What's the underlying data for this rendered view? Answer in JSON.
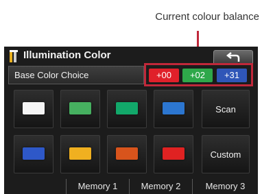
{
  "annotation": {
    "label": "Current colour balance"
  },
  "screen": {
    "title": "Illumination Color",
    "base_color_label": "Base Color Choice",
    "balance": [
      {
        "text": "+00",
        "color": "#e0202a"
      },
      {
        "text": "+02",
        "color": "#2ea84a"
      },
      {
        "text": "+31",
        "color": "#2f56b8"
      }
    ],
    "swatches": [
      {
        "color": "#f4f4f4"
      },
      {
        "color": "#46b060"
      },
      {
        "color": "#12a86a"
      },
      {
        "color": "#2c76d0"
      },
      {
        "color": "#2e58c8"
      },
      {
        "color": "#f0b020"
      },
      {
        "color": "#d8541c"
      },
      {
        "color": "#e02222"
      }
    ],
    "scan_label": "Scan",
    "custom_label": "Custom",
    "memory_tabs": [
      "Memory 1",
      "Memory 2",
      "Memory 3"
    ]
  }
}
